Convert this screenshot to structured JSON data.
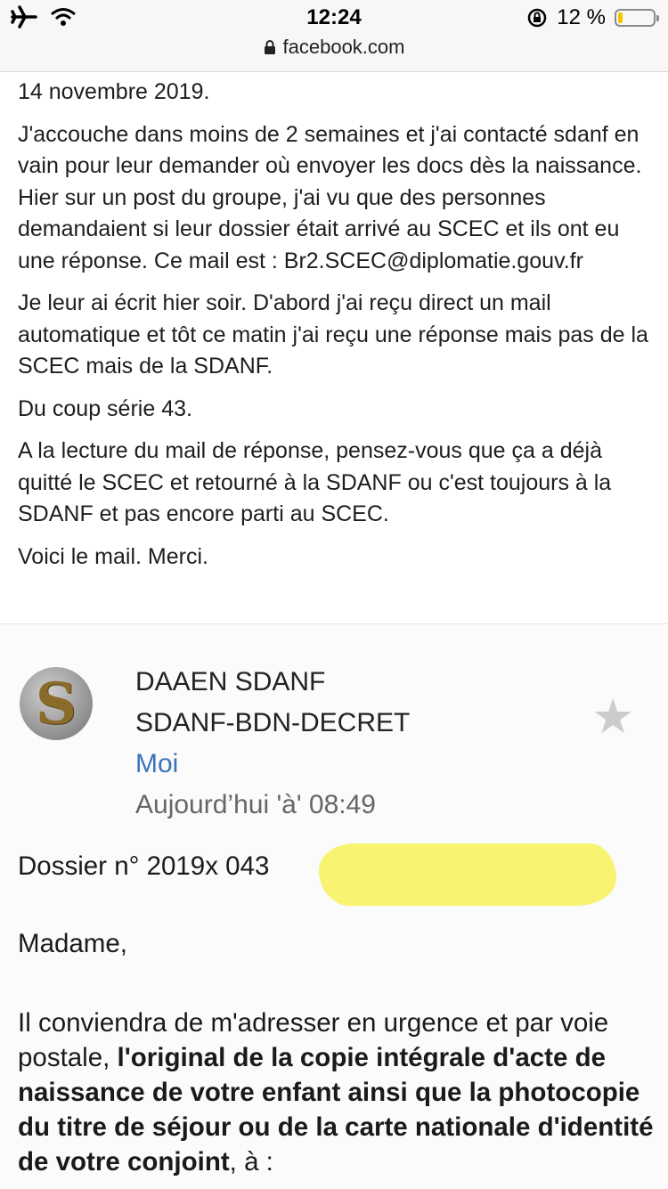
{
  "status_bar": {
    "time": "12:24",
    "battery_percent": "12 %",
    "battery_level": 0.12,
    "battery_color": "#f5c400",
    "icons": [
      "airplane-icon",
      "wifi-icon",
      "rotation-lock-icon",
      "battery-icon"
    ]
  },
  "browser": {
    "url": "facebook.com",
    "lock_icon": "lock-icon"
  },
  "post": {
    "date_line": "14 novembre 2019.",
    "paragraphs": [
      "J'accouche dans moins de 2 semaines et j'ai contacté sdanf en vain pour leur demander où envoyer les docs dès la naissance. Hier sur un post du groupe, j'ai vu que des personnes demandaient si leur dossier était arrivé au SCEC et ils ont eu une réponse. Ce mail est : Br2.SCEC@diplomatie.gouv.fr",
      "Je leur ai écrit hier soir. D'abord j'ai reçu direct un mail automatique et tôt ce matin j'ai reçu une réponse mais pas de la SCEC mais de la SDANF.",
      "Du coup série 43.",
      "A la lecture du mail de réponse, pensez-vous que ça a déjà quitté le SCEC et retourné à la SDANF ou c'est toujours à la SDANF et pas encore parti au SCEC.",
      "Voici le mail. Merci."
    ]
  },
  "email": {
    "avatar_letter": "S",
    "sender_name": "DAAEN SDANF",
    "sender_address": "SDANF-BDN-DECRET",
    "recipient": "Moi",
    "date": "Aujourd’hui 'à' 08:49",
    "dossier": "Dossier n° 2019x 043",
    "greeting": "Madame,",
    "body_intro": "Il conviendra de m'adresser en urgence et par voie postale, ",
    "body_bold": "l'original de la copie intégrale d'acte de naissance de votre enfant ainsi que la photocopie du titre de séjour ou de la carte nationale d'identité de votre conjoint",
    "body_end": ", à :",
    "highlight_color": "#f8f36a",
    "star_icon": "star-icon"
  }
}
